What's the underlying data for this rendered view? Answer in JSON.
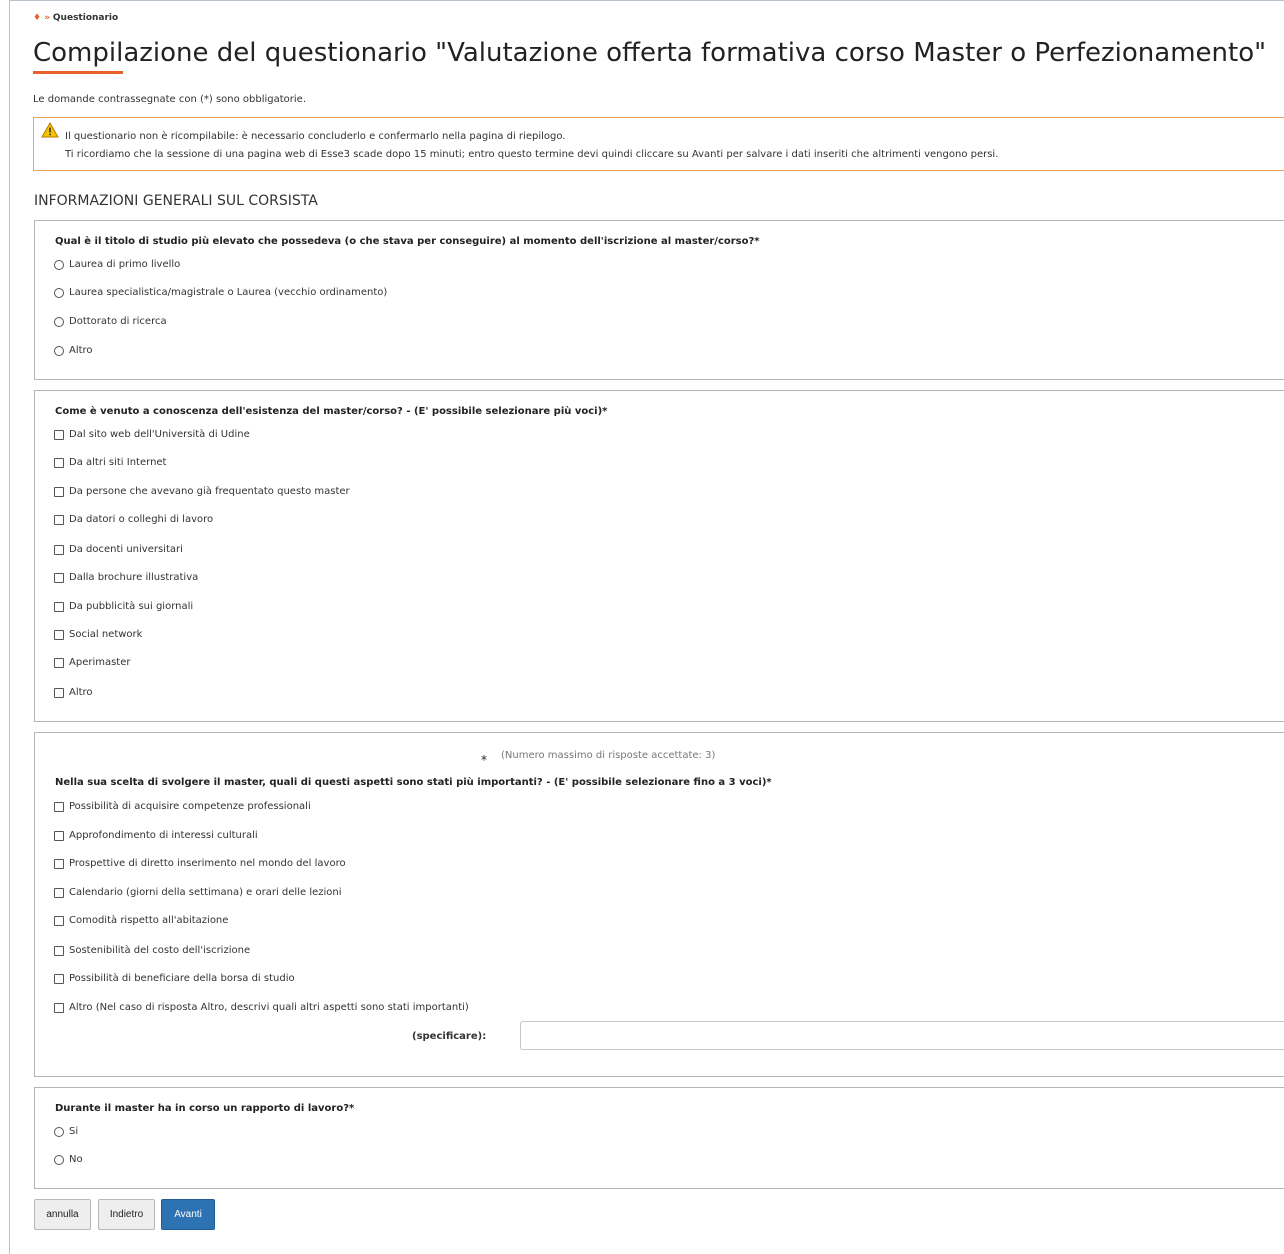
{
  "breadcrumb": {
    "home_icon": "home-icon",
    "separator": "»",
    "current": "Questionario"
  },
  "title": "Compilazione del questionario \"Valutazione offerta formativa corso Master o Perfezionamento\"",
  "mandatory_note": "Le domande contrassegnate con (*) sono obbligatorie.",
  "warning": {
    "icon": "warning-icon",
    "line1": "Il questionario non è ricompilabile: è necessario concluderlo e confermarlo nella pagina di riepilogo.",
    "line2": "Ti ricordiamo che la sessione di una pagina web di Esse3 scade dopo 15 minuti; entro questo termine devi quindi cliccare su Avanti per salvare i dati inseriti che altrimenti vengono persi."
  },
  "section_title": "INFORMAZIONI GENERALI SUL CORSISTA",
  "q1": {
    "text": "Qual è il titolo di studio più elevato che possedeva (o che stava per conseguire) al momento dell'iscrizione al master/corso?*",
    "options": [
      "Laurea di primo livello",
      "Laurea specialistica/magistrale o Laurea (vecchio ordinamento)",
      "Dottorato di ricerca",
      "Altro"
    ]
  },
  "q2": {
    "text": "Come è venuto a conoscenza dell'esistenza del master/corso? - (E' possibile selezionare più voci)*",
    "options": [
      "Dal sito web dell'Università di Udine",
      "Da altri siti Internet",
      "Da persone che avevano già frequentato questo master",
      "Da datori o colleghi di lavoro",
      "Da docenti universitari",
      "Dalla brochure illustrativa",
      "Da pubblicità sui giornali",
      "Social network",
      "Aperimaster",
      "Altro"
    ]
  },
  "q3": {
    "star": "*",
    "limit_note": "(Numero massimo di risposte accettate: 3)",
    "text": "Nella sua scelta di svolgere il master, quali di questi aspetti sono stati più importanti? - (E' possibile selezionare fino a 3 voci)*",
    "options": [
      "Possibilità di acquisire competenze professionali",
      "Approfondimento di interessi culturali",
      "Prospettive di diretto inserimento nel mondo del lavoro",
      "Calendario (giorni della settimana) e orari delle lezioni",
      "Comodità rispetto all'abitazione",
      "Sostenibilità del costo dell'iscrizione",
      "Possibilità di beneficiare della borsa di studio",
      "Altro (Nel caso di risposta Altro, descrivi quali altri aspetti sono stati importanti)"
    ],
    "specify_label": "(specificare):",
    "specify_value": ""
  },
  "q4": {
    "text": "Durante il master ha in corso un rapporto di lavoro?*",
    "options": [
      "Si",
      "No"
    ]
  },
  "buttons": {
    "cancel": "annulla",
    "back": "Indietro",
    "next": "Avanti"
  },
  "colors": {
    "accent": "#e8612c",
    "primary": "#2d73b3",
    "warning_border": "#f0a35a"
  }
}
